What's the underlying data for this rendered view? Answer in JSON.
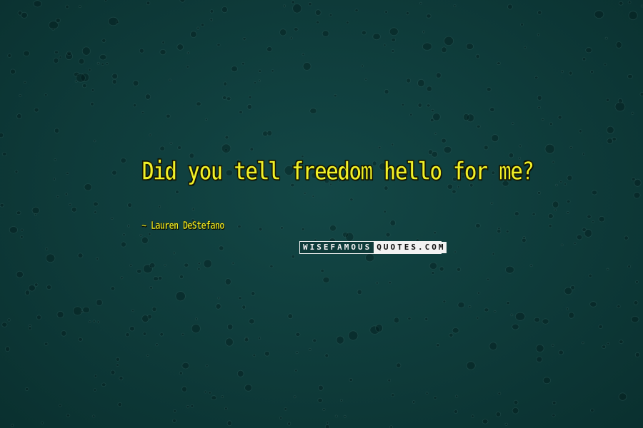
{
  "quote": {
    "text": "Did you tell freedom hello for me?",
    "author": "~ Lauren DeStefano"
  },
  "watermark": {
    "left": "WISEFAMOUS",
    "right": "QUOTES.COM"
  },
  "colors": {
    "background": "#0f3b3a",
    "text": "#f0f028",
    "watermark_light": "#f2f2f2"
  }
}
